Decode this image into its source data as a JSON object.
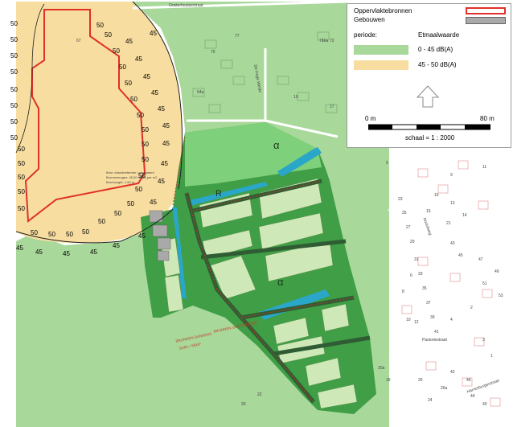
{
  "legend": {
    "items": [
      {
        "label": "Oppervlaktebronnen",
        "color": "#e0302a"
      },
      {
        "label": "Gebouwen",
        "color": "#a9a9a9"
      }
    ],
    "periode_label": "periode:",
    "periode_value": "Etmaalwaarde",
    "classes": [
      {
        "label": "0 - 45 dB(A)",
        "color": "#a8d89a"
      },
      {
        "label": "45 - 50 dB(A)",
        "color": "#f7dda0"
      }
    ],
    "north_icon": "north-arrow-icon",
    "scalebar": {
      "start_label": "0 m",
      "end_label": "80 m",
      "scale_text": "schaal = 1 : 2000"
    }
  },
  "colors": {
    "zone_0_45": "#a8d89a",
    "zone_45_50": "#f7dda0",
    "development_green": "#3f9e46",
    "light_green_band": "#7fd07a",
    "water": "#2aa6c9",
    "building_grey": "#a9a9a9",
    "source_red": "#e0302a"
  },
  "contour_labels": {
    "value_50": "50",
    "value_45": "45"
  },
  "map_text": {
    "street_top": "Oosterhoutsestraat",
    "street_mid": "De Hoge Weide",
    "street_right_1": "Noordweg",
    "street_right_2": "Pastoriestraat",
    "street_right_3": "Harrenburgerstraat",
    "source_note_1": "Bron: industrieterrein / permanent",
    "source_note_2": "Bronvermogen: 45,00 dB(A) per m2",
    "source_note_3": "Bronhoogte: 1,50 m",
    "source_label_a": "BRONNEN DUNKERS",
    "source_label_b": "SOB1 / SBGF",
    "source_label_c": "BRONNEN OOSTERHOUT",
    "letter_r": "R",
    "letter_alpha": "α"
  },
  "house_numbers": [
    "67",
    "75",
    "77",
    "71",
    "72",
    "5",
    "9",
    "11",
    "16",
    "13",
    "14",
    "15",
    "21",
    "23",
    "25",
    "27",
    "29",
    "31",
    "33",
    "35",
    "37",
    "39",
    "41",
    "43",
    "45",
    "47",
    "49",
    "51",
    "53",
    "2",
    "4",
    "6",
    "8",
    "10",
    "12",
    "3",
    "1",
    "46",
    "44",
    "40",
    "42",
    "26a",
    "26",
    "24",
    "22",
    "20",
    "20a",
    "18",
    "16a",
    "17",
    "19",
    "54a"
  ]
}
